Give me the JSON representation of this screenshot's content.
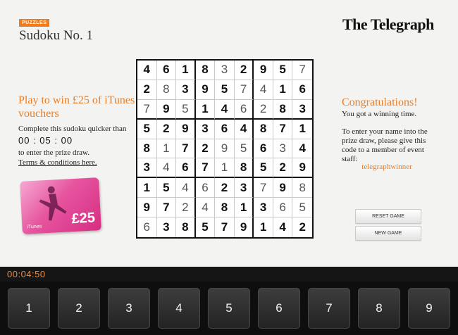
{
  "header": {
    "badge": "PUZZLES",
    "title": "Sudoku No. 1",
    "brand": "The Telegraph"
  },
  "promo": {
    "headline": "Play to win £25 of iTunes vouchers",
    "instruction": "Complete this sudoku quicker than",
    "target_time": "00 : 05 : 00",
    "prize_text": "to enter the prize draw.",
    "terms_link": "Terms & conditions here.",
    "card": {
      "amount": "£25",
      "brand": "iTunes"
    }
  },
  "grid": {
    "rows": [
      [
        [
          "4",
          "g"
        ],
        [
          "6",
          "g"
        ],
        [
          "1",
          "g"
        ],
        [
          "8",
          "g"
        ],
        [
          "3",
          "u"
        ],
        [
          "2",
          "g"
        ],
        [
          "9",
          "g"
        ],
        [
          "5",
          "g"
        ],
        [
          "7",
          "u"
        ]
      ],
      [
        [
          "2",
          "g"
        ],
        [
          "8",
          "u"
        ],
        [
          "3",
          "g"
        ],
        [
          "9",
          "g"
        ],
        [
          "5",
          "g"
        ],
        [
          "7",
          "u"
        ],
        [
          "4",
          "u"
        ],
        [
          "1",
          "g"
        ],
        [
          "6",
          "g"
        ]
      ],
      [
        [
          "7",
          "u"
        ],
        [
          "9",
          "g"
        ],
        [
          "5",
          "u"
        ],
        [
          "1",
          "g"
        ],
        [
          "4",
          "g"
        ],
        [
          "6",
          "u"
        ],
        [
          "2",
          "u"
        ],
        [
          "8",
          "g"
        ],
        [
          "3",
          "g"
        ]
      ],
      [
        [
          "5",
          "g"
        ],
        [
          "2",
          "g"
        ],
        [
          "9",
          "g"
        ],
        [
          "3",
          "g"
        ],
        [
          "6",
          "g"
        ],
        [
          "4",
          "g"
        ],
        [
          "8",
          "g"
        ],
        [
          "7",
          "g"
        ],
        [
          "1",
          "g"
        ]
      ],
      [
        [
          "8",
          "g"
        ],
        [
          "1",
          "u"
        ],
        [
          "7",
          "g"
        ],
        [
          "2",
          "g"
        ],
        [
          "9",
          "u"
        ],
        [
          "5",
          "u"
        ],
        [
          "6",
          "g"
        ],
        [
          "3",
          "u"
        ],
        [
          "4",
          "g"
        ]
      ],
      [
        [
          "3",
          "g"
        ],
        [
          "4",
          "u"
        ],
        [
          "6",
          "g"
        ],
        [
          "7",
          "g"
        ],
        [
          "1",
          "u"
        ],
        [
          "8",
          "g"
        ],
        [
          "5",
          "g"
        ],
        [
          "2",
          "g"
        ],
        [
          "9",
          "g"
        ]
      ],
      [
        [
          "1",
          "g"
        ],
        [
          "5",
          "g"
        ],
        [
          "4",
          "u"
        ],
        [
          "6",
          "u"
        ],
        [
          "2",
          "g"
        ],
        [
          "3",
          "g"
        ],
        [
          "7",
          "u"
        ],
        [
          "9",
          "g"
        ],
        [
          "8",
          "u"
        ]
      ],
      [
        [
          "9",
          "g"
        ],
        [
          "7",
          "g"
        ],
        [
          "2",
          "u"
        ],
        [
          "4",
          "u"
        ],
        [
          "8",
          "g"
        ],
        [
          "1",
          "g"
        ],
        [
          "3",
          "g"
        ],
        [
          "6",
          "u"
        ],
        [
          "5",
          "u"
        ]
      ],
      [
        [
          "6",
          "u"
        ],
        [
          "3",
          "g"
        ],
        [
          "8",
          "g"
        ],
        [
          "5",
          "g"
        ],
        [
          "7",
          "g"
        ],
        [
          "9",
          "g"
        ],
        [
          "1",
          "g"
        ],
        [
          "4",
          "g"
        ],
        [
          "2",
          "g"
        ]
      ]
    ]
  },
  "result": {
    "title": "Congratulations!",
    "message": "You got a winning time.",
    "instructions": "To enter your name into the prize draw, please give this code to a member of event staff:",
    "code": "telegraphwinner"
  },
  "buttons": {
    "reset": "RESET GAME",
    "new": "NEW GAME"
  },
  "timer": "00:04:50",
  "keypad": [
    "1",
    "2",
    "3",
    "4",
    "5",
    "6",
    "7",
    "8",
    "9"
  ],
  "colors": {
    "accent": "#ee7d24",
    "background": "#f3f3f1",
    "bar": "#151515"
  }
}
